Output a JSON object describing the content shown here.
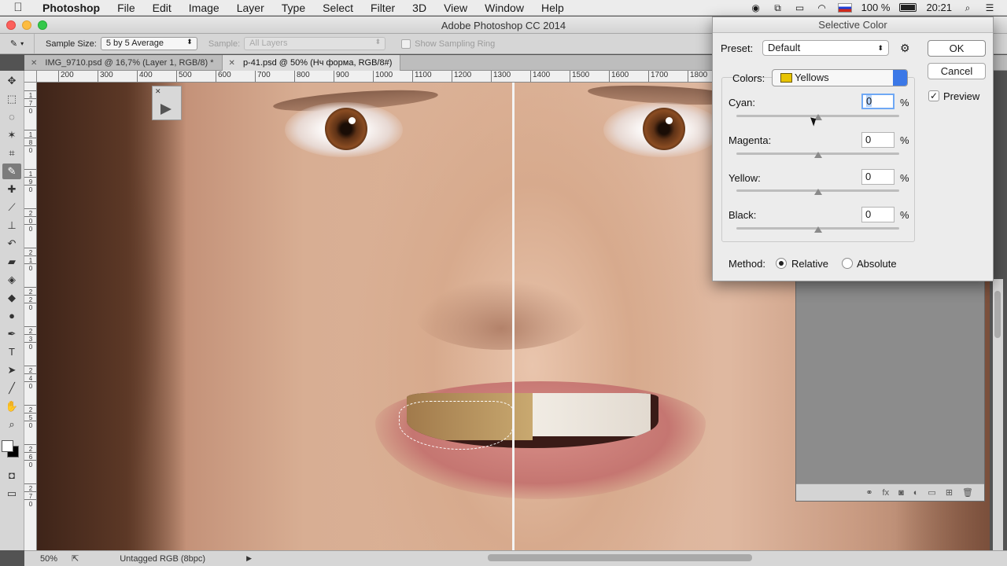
{
  "menubar": {
    "apple_icon": "apple-icon",
    "items": [
      "Photoshop",
      "File",
      "Edit",
      "Image",
      "Layer",
      "Type",
      "Select",
      "Filter",
      "3D",
      "View",
      "Window",
      "Help"
    ],
    "battery": "100 %",
    "clock": "20:21"
  },
  "window": {
    "title": "Adobe Photoshop CC 2014"
  },
  "options": {
    "sample_size_label": "Sample Size:",
    "sample_size_value": "5 by 5 Average",
    "sample_label": "Sample:",
    "sample_value": "All Layers",
    "show_ring_label": "Show Sampling Ring"
  },
  "tabs": [
    {
      "label": "IMG_9710.psd @ 16,7% (Layer 1, RGB/8) *"
    },
    {
      "label": "p-41.psd @ 50% (Нч форма, RGB/8#)"
    }
  ],
  "ruler_top": [
    "200",
    "300",
    "400",
    "500",
    "600",
    "700",
    "800",
    "900",
    "1000",
    "1100",
    "1200",
    "1300",
    "1400",
    "1500",
    "1600",
    "1700",
    "1800"
  ],
  "ruler_left": [
    "1",
    "7",
    "0",
    "1",
    "8",
    "0",
    "1",
    "9",
    "0",
    "2",
    "0",
    "0",
    "2",
    "1",
    "0",
    "2",
    "2",
    "0",
    "2",
    "3",
    "0",
    "2",
    "4",
    "0",
    "2",
    "5",
    "0",
    "2",
    "6",
    "0",
    "2",
    "7",
    "0"
  ],
  "statusbar": {
    "zoom": "50%",
    "doc_profile": "Untagged RGB (8bpc)"
  },
  "dialog": {
    "title": "Selective Color",
    "preset_label": "Preset:",
    "preset_value": "Default",
    "ok_label": "OK",
    "cancel_label": "Cancel",
    "preview_label": "Preview",
    "preview_checked": true,
    "colors_label": "Colors:",
    "colors_value": "Yellows",
    "colors_swatch": "#e8c400",
    "sliders": [
      {
        "label": "Cyan:",
        "value": "0",
        "unit": "%",
        "position": 0.5
      },
      {
        "label": "Magenta:",
        "value": "0",
        "unit": "%",
        "position": 0.5
      },
      {
        "label": "Yellow:",
        "value": "0",
        "unit": "%",
        "position": 0.5
      },
      {
        "label": "Black:",
        "value": "0",
        "unit": "%",
        "position": 0.5
      }
    ],
    "method_label": "Method:",
    "method_relative": "Relative",
    "method_absolute": "Absolute",
    "method_selected": "Relative"
  },
  "icons": {
    "toolbar": [
      "move-tool-icon",
      "marquee-tool-icon",
      "lasso-tool-icon",
      "quick-select-tool-icon",
      "crop-tool-icon",
      "eyedropper-tool-icon",
      "healing-brush-icon",
      "brush-tool-icon",
      "clone-stamp-icon",
      "history-brush-icon",
      "eraser-tool-icon",
      "paint-bucket-icon",
      "blur-tool-icon",
      "dodge-tool-icon",
      "pen-tool-icon",
      "type-tool-icon",
      "path-select-icon",
      "line-tool-icon",
      "hand-tool-icon",
      "zoom-tool-icon"
    ]
  }
}
